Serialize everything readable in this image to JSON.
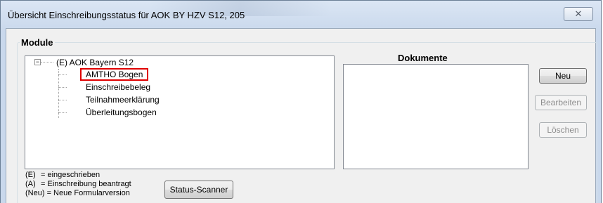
{
  "window": {
    "title": "Übersicht Einschreibungsstatus für AOK BY HZV S12, 205",
    "close_symbol": "✕"
  },
  "module_group": {
    "label": "Module",
    "tree": {
      "expander": "−",
      "root": "(E) AOK Bayern S12",
      "children": [
        {
          "label": "AMTHO Bogen",
          "selected": true
        },
        {
          "label": "Einschreibebeleg",
          "selected": false
        },
        {
          "label": "Teilnahmeerklärung",
          "selected": false
        },
        {
          "label": "Überleitungsbogen",
          "selected": false
        }
      ]
    }
  },
  "documents": {
    "label": "Dokumente",
    "items": []
  },
  "buttons": {
    "new": "Neu",
    "edit": "Bearbeiten",
    "delete": "Löschen",
    "scanner": "Status-Scanner"
  },
  "legend": [
    {
      "key": "(E)",
      "text": "= eingeschrieben"
    },
    {
      "key": "(A)",
      "text": "= Einschreibung beantragt"
    },
    {
      "key": "(Neu)",
      "text": "= Neue Formularversion"
    }
  ],
  "colors": {
    "highlight_border": "#e00000",
    "dialog_background": "#f0f0f0"
  }
}
